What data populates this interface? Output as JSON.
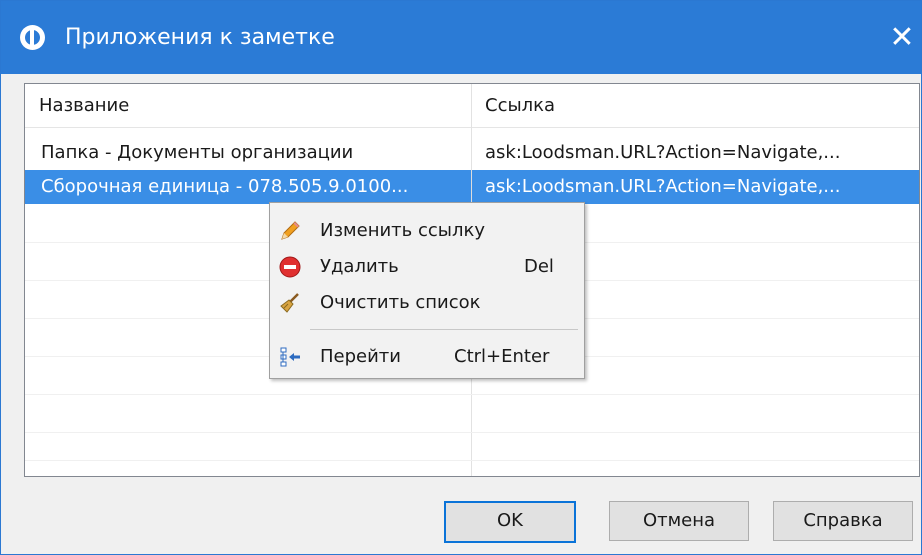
{
  "window": {
    "title": "Приложения к заметке"
  },
  "icons": {
    "app": "app-logo-icon",
    "close": "close-icon",
    "edit": "pencil-icon",
    "delete": "delete-circle-icon",
    "clear": "broom-icon",
    "goto": "tree-arrow-icon"
  },
  "table": {
    "columns": [
      "Название",
      "Ссылка"
    ],
    "rows": [
      {
        "name": "Папка  -  Документы организации",
        "link": "ask:Loodsman.URL?Action=Navigate,..."
      },
      {
        "name": "Сборочная единица  -  078.505.9.0100...",
        "link": "ask:Loodsman.URL?Action=Navigate,...",
        "selected": true
      }
    ]
  },
  "context_menu": {
    "items": [
      {
        "label": "Изменить ссылку",
        "shortcut": ""
      },
      {
        "label": "Удалить",
        "shortcut": "Del"
      },
      {
        "label": "Очистить список",
        "shortcut": ""
      },
      {
        "label": "Перейти",
        "shortcut": "Ctrl+Enter"
      }
    ]
  },
  "buttons": {
    "ok": "OK",
    "cancel": "Отмена",
    "help": "Справка"
  },
  "colors": {
    "titlebar": "#2b7bd6",
    "selection": "#3a8ee6",
    "default_button_border": "#0a73d8"
  }
}
